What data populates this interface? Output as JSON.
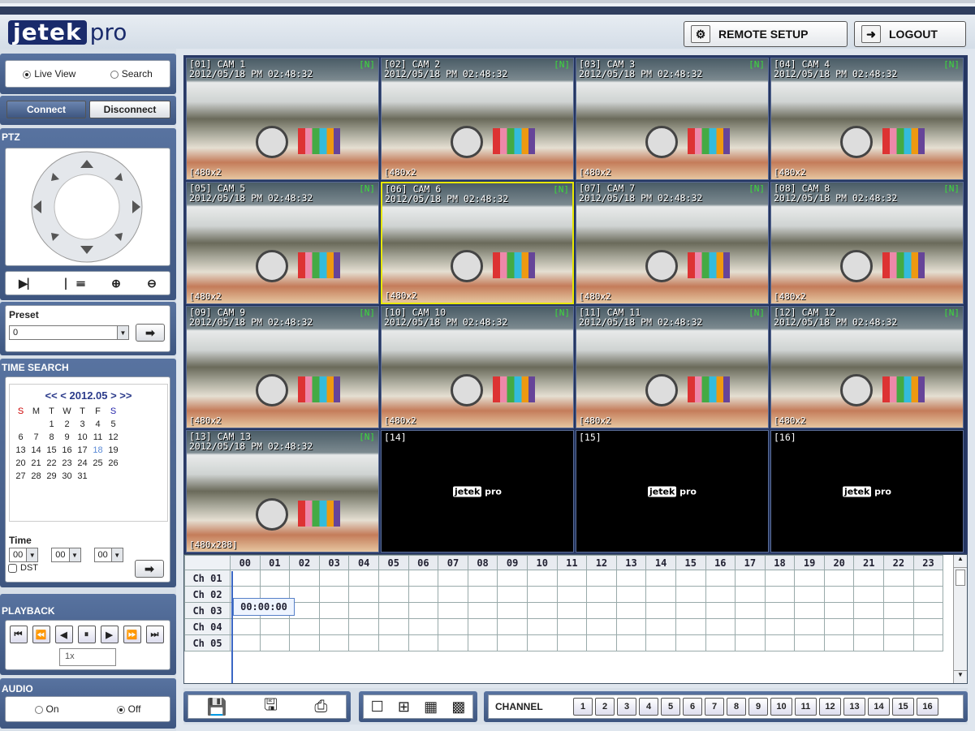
{
  "header": {
    "logo_a": "jetek",
    "logo_b": "pro",
    "remote_setup": "REMOTE SETUP",
    "logout": "LOGOUT"
  },
  "mode": {
    "live": "Live View",
    "search": "Search",
    "selected": "live"
  },
  "conn": {
    "connect": "Connect",
    "disconnect": "Disconnect"
  },
  "ptz": {
    "title": "PTZ"
  },
  "preset": {
    "label": "Preset",
    "value": "0"
  },
  "time_search": {
    "title": "TIME SEARCH",
    "month": "<< < 2012.05 > >>",
    "weekdays": [
      "S",
      "M",
      "T",
      "W",
      "T",
      "F",
      "S"
    ],
    "weeks": [
      [
        "",
        "",
        "1",
        "2",
        "3",
        "4",
        "5"
      ],
      [
        "6",
        "7",
        "8",
        "9",
        "10",
        "11",
        "12"
      ],
      [
        "13",
        "14",
        "15",
        "16",
        "17",
        "18",
        "19"
      ],
      [
        "20",
        "21",
        "22",
        "23",
        "24",
        "25",
        "26"
      ],
      [
        "27",
        "28",
        "29",
        "30",
        "31",
        "",
        ""
      ]
    ],
    "time_label": "Time",
    "hh": "00",
    "mm": "00",
    "ss": "00",
    "dst": "DST"
  },
  "playback": {
    "title": "PLAYBACK",
    "speed": "1x"
  },
  "audio": {
    "title": "AUDIO",
    "on": "On",
    "off": "Off",
    "selected": "off"
  },
  "cams": [
    {
      "id": "[01] CAM 1",
      "ts": "2012/05/18 PM 02:48:32",
      "flag": "[N]",
      "res": "[480x2"
    },
    {
      "id": "[02] CAM 2",
      "ts": "2012/05/18 PM 02:48:32",
      "flag": "[N]",
      "res": "[480x2"
    },
    {
      "id": "[03] CAM 3",
      "ts": "2012/05/18 PM 02:48:32",
      "flag": "[N]",
      "res": "[480x2"
    },
    {
      "id": "[04] CAM 4",
      "ts": "2012/05/18 PM 02:48:32",
      "flag": "[N]",
      "res": "[480x2"
    },
    {
      "id": "[05] CAM 5",
      "ts": "2012/05/18 PM 02:48:32",
      "flag": "[N]",
      "res": "[480x2"
    },
    {
      "id": "[06] CAM 6",
      "ts": "2012/05/18 PM 02:48:32",
      "flag": "[N]",
      "res": "[480x2"
    },
    {
      "id": "[07] CAM 7",
      "ts": "2012/05/18 PM 02:48:32",
      "flag": "[N]",
      "res": "[480x2"
    },
    {
      "id": "[08] CAM 8",
      "ts": "2012/05/18 PM 02:48:32",
      "flag": "[N]",
      "res": "[480x2"
    },
    {
      "id": "[09] CAM 9",
      "ts": "2012/05/18 PM 02:48:32",
      "flag": "[N]",
      "res": "[480x2"
    },
    {
      "id": "[10] CAM 10",
      "ts": "2012/05/18 PM 02:48:32",
      "flag": "[N]",
      "res": "[480x2"
    },
    {
      "id": "[11] CAM 11",
      "ts": "2012/05/18 PM 02:48:32",
      "flag": "[N]",
      "res": "[480x2"
    },
    {
      "id": "[12] CAM 12",
      "ts": "2012/05/18 PM 02:48:32",
      "flag": "[N]",
      "res": "[480x2"
    },
    {
      "id": "[13] CAM 13",
      "ts": "2012/05/18 PM 02:48:32",
      "flag": "[N]",
      "res": "[480x288]"
    }
  ],
  "empty": [
    {
      "id": "[14]"
    },
    {
      "id": "[15]"
    },
    {
      "id": "[16]"
    }
  ],
  "watermark": {
    "a": "jetek",
    "b": "pro"
  },
  "timeline": {
    "hours": [
      "00",
      "01",
      "02",
      "03",
      "04",
      "05",
      "06",
      "07",
      "08",
      "09",
      "10",
      "11",
      "12",
      "13",
      "14",
      "15",
      "16",
      "17",
      "18",
      "19",
      "20",
      "21",
      "22",
      "23"
    ],
    "channels": [
      "Ch 01",
      "Ch 02",
      "Ch 03",
      "Ch 04",
      "Ch 05"
    ],
    "cursor": "00:00:00"
  },
  "bottom": {
    "channel_label": "CHANNEL",
    "channels": [
      "1",
      "2",
      "3",
      "4",
      "5",
      "6",
      "7",
      "8",
      "9",
      "10",
      "11",
      "12",
      "13",
      "14",
      "15",
      "16"
    ]
  },
  "colors": {
    "accent": "#3e5680",
    "selected_tile": "#e8e800"
  }
}
